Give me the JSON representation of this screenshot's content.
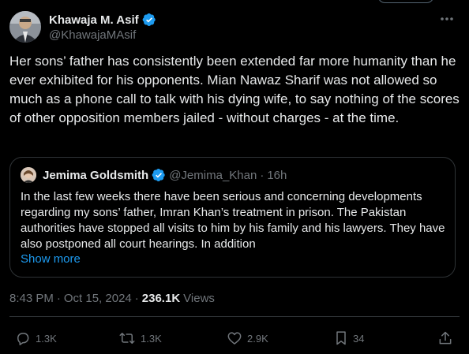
{
  "author": {
    "display_name": "Khawaja M. Asif",
    "handle": "@KhawajaMAsif"
  },
  "tweet": {
    "text": "Her sons’ father has consistently been extended far more humanity than he ever exhibited for his opponents. Mian Nawaz Sharif was not allowed so much as a phone call to talk with his dying wife, to say nothing of the scores of other opposition members jailed - without charges - at the time."
  },
  "quote": {
    "display_name": "Jemima Goldsmith",
    "handle": "@Jemima_Khan",
    "separator": "·",
    "time": "16h",
    "text": "In the last few weeks there have been serious and concerning developments regarding my sons’ father, Imran Khan’s treatment in prison. The Pakistan authorities have stopped all visits to him by his family and his lawyers. They have also postponed all court hearings. In addition",
    "show_more": "Show more"
  },
  "meta": {
    "time": "8:43 PM",
    "separator": "·",
    "date": "Oct 15, 2024",
    "views_count": "236.1K",
    "views_label": "Views"
  },
  "actions": {
    "replies": "1.3K",
    "reposts": "1.3K",
    "likes": "2.9K",
    "bookmarks": "34"
  },
  "icons": {
    "verified": "verified-badge-icon",
    "more": "more-horizontal-icon",
    "reply": "reply-icon",
    "repost": "repost-icon",
    "like": "heart-icon",
    "bookmark": "bookmark-icon",
    "share": "share-icon"
  },
  "colors": {
    "background": "#000000",
    "text": "#e7e9ea",
    "secondary": "#71767b",
    "accent": "#1d9bf0",
    "border": "#2f3336"
  }
}
